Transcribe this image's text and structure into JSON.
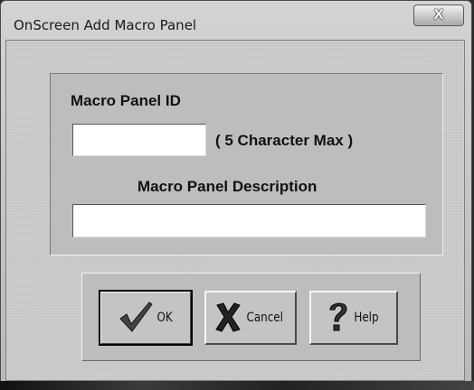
{
  "window": {
    "title": "OnScreen Add Macro Panel",
    "close_label": "X"
  },
  "form": {
    "id_label": "Macro Panel ID",
    "id_value": "",
    "id_hint": "( 5 Character Max )",
    "description_label": "Macro Panel Description",
    "description_value": ""
  },
  "buttons": {
    "ok_label": "OK",
    "cancel_label": "Cancel",
    "help_label": "Help"
  },
  "icons": {
    "ok": "checkmark-icon",
    "cancel": "x-mark-icon",
    "help": "question-mark-icon"
  },
  "colors": {
    "dialog_face": "#c7c7c7",
    "group_face": "#bdbdbd",
    "field_bg": "#ffffff"
  }
}
